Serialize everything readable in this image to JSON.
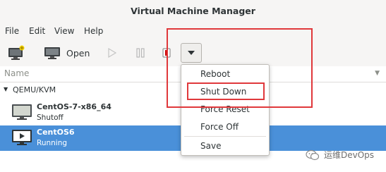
{
  "window": {
    "title": "Virtual Machine Manager"
  },
  "menubar": {
    "items": [
      "File",
      "Edit",
      "View",
      "Help"
    ]
  },
  "toolbar": {
    "open_label": "Open"
  },
  "list": {
    "column_header": "Name",
    "group": "QEMU/KVM",
    "vms": [
      {
        "name": "CentOS-7-x86_64",
        "status": "Shutoff",
        "selected": false
      },
      {
        "name": "CentOS6",
        "status": "Running",
        "selected": true
      }
    ]
  },
  "dropdown": {
    "items": [
      "Reboot",
      "Shut Down",
      "Force Reset",
      "Force Off",
      "Save"
    ],
    "highlighted": "Shut Down"
  },
  "watermark": {
    "text": "运维DevOps"
  },
  "colors": {
    "selection": "#4a90d9",
    "annotation": "#e0383b",
    "stop_button": "#cc0000"
  }
}
